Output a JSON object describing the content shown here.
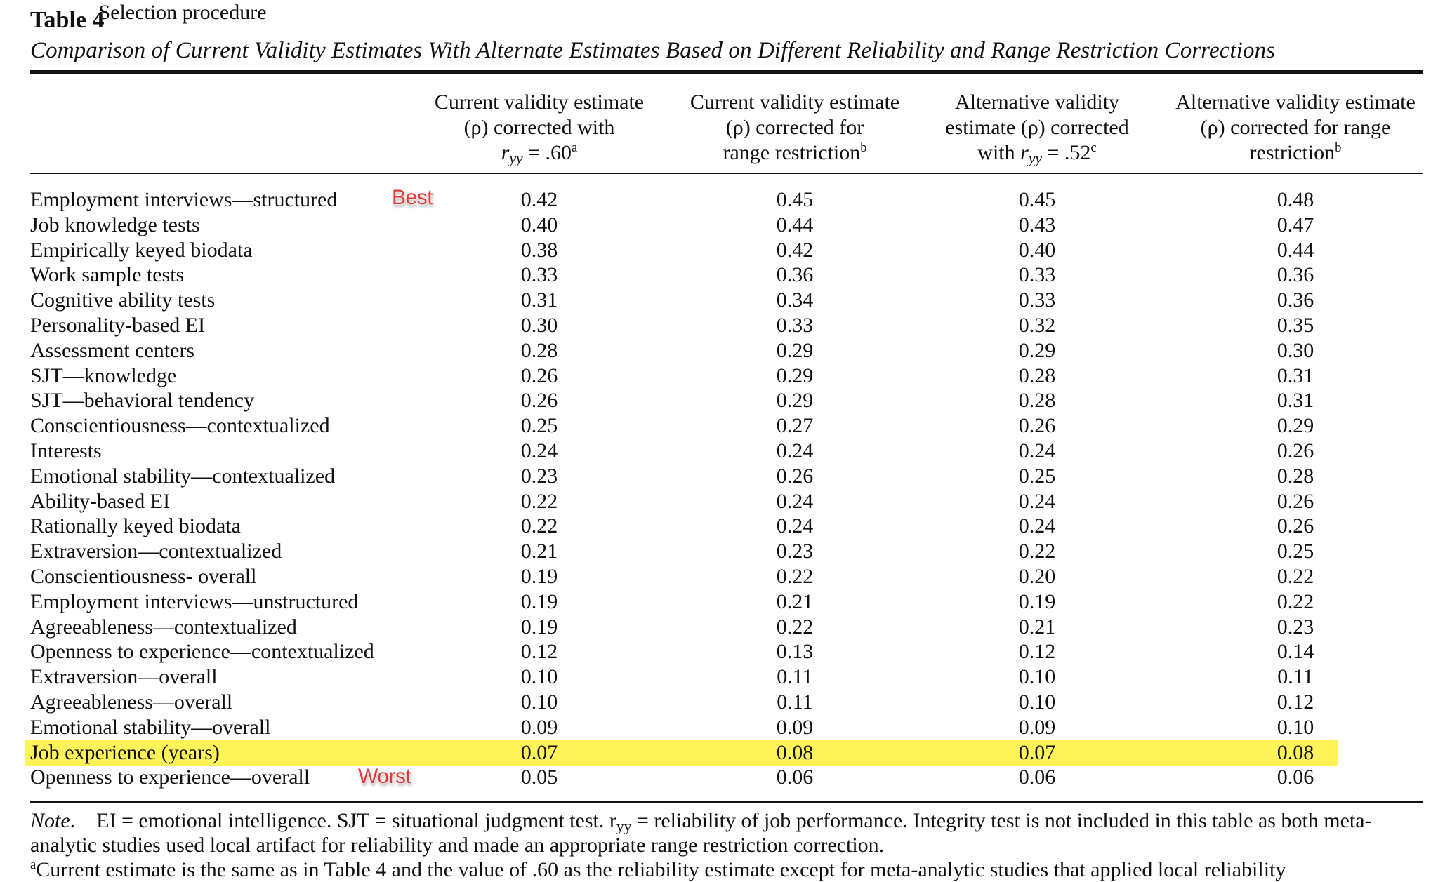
{
  "table": {
    "number": "Table 4",
    "title": "Comparison of Current Validity Estimates With Alternate Estimates Based on Different Reliability and Range Restriction Corrections",
    "columns": {
      "procedure": "Selection procedure",
      "col1": {
        "line1": "Current validity estimate",
        "line2": "(ρ) corrected with",
        "r": "r",
        "sub": "yy",
        "eq": " = .60",
        "sup": "a"
      },
      "col2": {
        "line1": "Current validity estimate",
        "line2": "(ρ) corrected for",
        "line3": "range restriction",
        "sup": "b"
      },
      "col3": {
        "line1": "Alternative validity",
        "line2": "estimate (ρ) corrected",
        "pre": "with ",
        "r": "r",
        "sub": "yy",
        "eq": " = .52",
        "sup": "c"
      },
      "col4": {
        "line1": "Alternative validity estimate",
        "line2": "(ρ) corrected for range",
        "line3": "restriction",
        "sup": "b"
      }
    },
    "rows": [
      {
        "procedure": "Employment interviews—structured",
        "values": [
          "0.42",
          "0.45",
          "0.45",
          "0.48"
        ]
      },
      {
        "procedure": "Job knowledge tests",
        "values": [
          "0.40",
          "0.44",
          "0.43",
          "0.47"
        ]
      },
      {
        "procedure": "Empirically keyed biodata",
        "values": [
          "0.38",
          "0.42",
          "0.40",
          "0.44"
        ]
      },
      {
        "procedure": "Work sample tests",
        "values": [
          "0.33",
          "0.36",
          "0.33",
          "0.36"
        ]
      },
      {
        "procedure": "Cognitive ability tests",
        "values": [
          "0.31",
          "0.34",
          "0.33",
          "0.36"
        ]
      },
      {
        "procedure": "Personality-based EI",
        "values": [
          "0.30",
          "0.33",
          "0.32",
          "0.35"
        ]
      },
      {
        "procedure": "Assessment centers",
        "values": [
          "0.28",
          "0.29",
          "0.29",
          "0.30"
        ]
      },
      {
        "procedure": "SJT—knowledge",
        "values": [
          "0.26",
          "0.29",
          "0.28",
          "0.31"
        ]
      },
      {
        "procedure": "SJT—behavioral tendency",
        "values": [
          "0.26",
          "0.29",
          "0.28",
          "0.31"
        ]
      },
      {
        "procedure": "Conscientiousness—contextualized",
        "values": [
          "0.25",
          "0.27",
          "0.26",
          "0.29"
        ]
      },
      {
        "procedure": "Interests",
        "values": [
          "0.24",
          "0.24",
          "0.24",
          "0.26"
        ]
      },
      {
        "procedure": "Emotional stability—contextualized",
        "values": [
          "0.23",
          "0.26",
          "0.25",
          "0.28"
        ]
      },
      {
        "procedure": "Ability-based EI",
        "values": [
          "0.22",
          "0.24",
          "0.24",
          "0.26"
        ]
      },
      {
        "procedure": "Rationally keyed biodata",
        "values": [
          "0.22",
          "0.24",
          "0.24",
          "0.26"
        ]
      },
      {
        "procedure": "Extraversion—contextualized",
        "values": [
          "0.21",
          "0.23",
          "0.22",
          "0.25"
        ]
      },
      {
        "procedure": "Conscientiousness- overall",
        "values": [
          "0.19",
          "0.22",
          "0.20",
          "0.22"
        ]
      },
      {
        "procedure": "Employment interviews—unstructured",
        "values": [
          "0.19",
          "0.21",
          "0.19",
          "0.22"
        ]
      },
      {
        "procedure": "Agreeableness—contextualized",
        "values": [
          "0.19",
          "0.22",
          "0.21",
          "0.23"
        ]
      },
      {
        "procedure": "Openness to experience—contextualized",
        "values": [
          "0.12",
          "0.13",
          "0.12",
          "0.14"
        ]
      },
      {
        "procedure": "Extraversion—overall",
        "values": [
          "0.10",
          "0.11",
          "0.10",
          "0.11"
        ]
      },
      {
        "procedure": "Agreeableness—overall",
        "values": [
          "0.10",
          "0.11",
          "0.10",
          "0.12"
        ]
      },
      {
        "procedure": "Emotional stability—overall",
        "values": [
          "0.09",
          "0.09",
          "0.09",
          "0.10"
        ]
      },
      {
        "procedure": "Job experience (years)",
        "values": [
          "0.07",
          "0.08",
          "0.07",
          "0.08"
        ],
        "highlighted": true
      },
      {
        "procedure": "Openness to experience—overall",
        "values": [
          "0.05",
          "0.06",
          "0.06",
          "0.06"
        ]
      }
    ],
    "highlight_color": "#fff35a"
  },
  "annotations": {
    "best": {
      "label": "Best",
      "color": "#e03a3a"
    },
    "worst": {
      "label": "Worst",
      "color": "#e03a3a"
    }
  },
  "note": {
    "label": "Note",
    "line1_rest": "EI = emotional intelligence. SJT = situational judgment test. r",
    "line1_sub": "yy",
    "line1_tail": " = reliability of job performance. Integrity test is not included in this table as both meta-",
    "line2": "analytic studies used local artifact for reliability and made an appropriate range restriction correction.",
    "line3_sup": "a",
    "line3": "Current estimate is the same as in Table 4 and the value of .60 as the reliability estimate except for meta-analytic studies that applied local reliability"
  }
}
